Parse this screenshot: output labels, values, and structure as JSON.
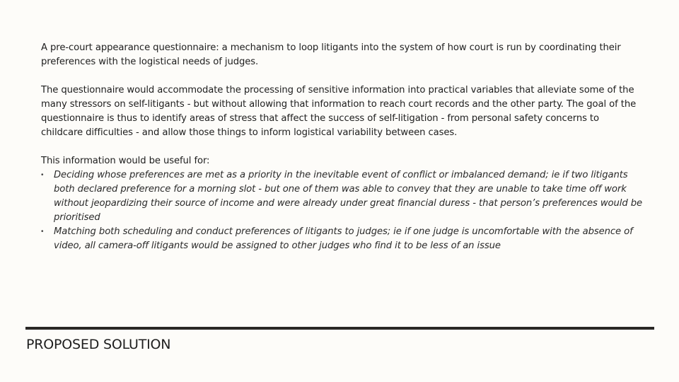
{
  "paragraphs": [
    "A pre-court appearance questionnaire: a mechanism to loop litigants into the system of how court is run by coordinating their preferences with the logistical needs of judges.",
    "The questionnaire would accommodate the processing of sensitive information into practical variables that alleviate some of the many stressors on self-litigants - but without allowing that information to reach court records and the other party. The goal of the questionnaire is thus to identify areas of stress that affect the success of self-litigation - from personal safety concerns to childcare difficulties - and allow those things to inform logistical variability between cases."
  ],
  "list": {
    "intro": "This information would be useful for:",
    "bullet_glyph": "•",
    "items": [
      "Deciding whose preferences are met as a priority in the inevitable event of conflict or imbalanced demand; ie if two litigants both declared preference for a morning slot - but one of them was able to convey that they are unable to take time off work without jeopardizing their source of income and were already under great financial duress - that person’s preferences would be prioritised",
      "Matching both scheduling and conduct preferences of litigants to judges; ie if one judge is uncomfortable with the absence of video, all camera-off litigants would be assigned to other judges who find it to be less of an issue"
    ]
  },
  "footer": {
    "section_title": "PROPOSED SOLUTION"
  },
  "colors": {
    "background": "#fdfcf9",
    "text": "#1e1e1e",
    "rule": "#2a2826"
  }
}
